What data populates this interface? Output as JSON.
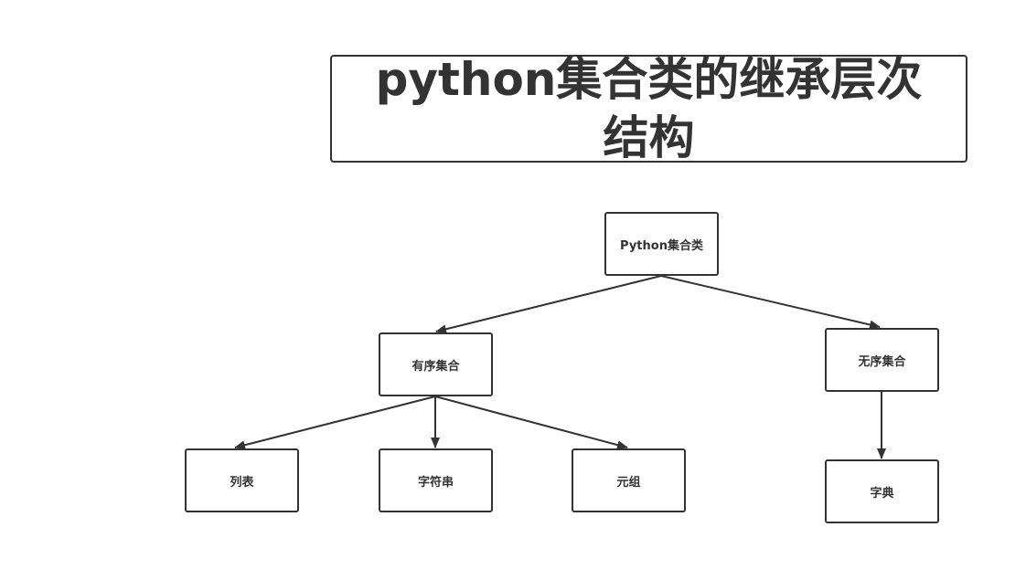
{
  "title": "python集合类的继承层次结构",
  "colors": {
    "stroke": "#333333",
    "background": "#ffffff"
  },
  "nodes": {
    "root": "Python集合类",
    "ordered": "有序集合",
    "unordered": "无序集合",
    "list": "列表",
    "string": "字符串",
    "tuple": "元组",
    "dict": "字典"
  }
}
